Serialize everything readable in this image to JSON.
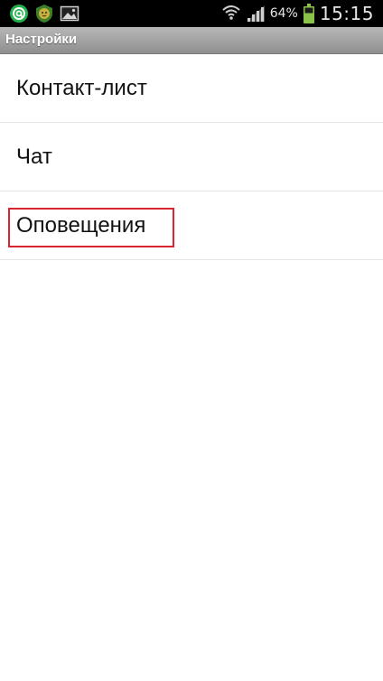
{
  "status_bar": {
    "battery": "64%",
    "time": "15:15",
    "icons": [
      "at-sign-notification-icon",
      "lion-app-notification-icon",
      "image-notification-icon",
      "wifi-icon",
      "signal-icon",
      "battery-icon"
    ],
    "battery_color": "#8bc34a"
  },
  "header": {
    "title": "Настройки"
  },
  "settings": {
    "items": [
      {
        "label": "Контакт-лист"
      },
      {
        "label": "Чат"
      },
      {
        "label": "Оповещения"
      }
    ]
  },
  "colors": {
    "highlight": "#d9252f",
    "notif_green": "#23b14d"
  }
}
